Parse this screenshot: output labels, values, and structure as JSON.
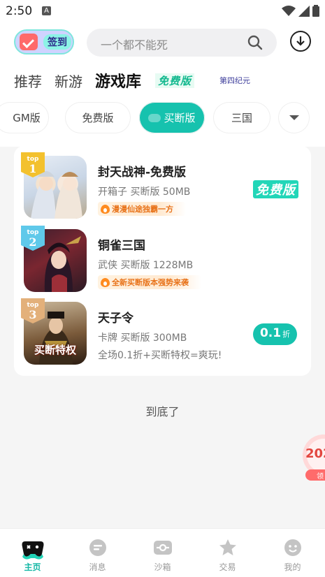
{
  "status_bar": {
    "time": "2:50",
    "badge": "A"
  },
  "header": {
    "signin_label": "签到",
    "search_placeholder": "一个都不能死"
  },
  "top_tabs": [
    {
      "label": "推荐"
    },
    {
      "label": "新游"
    },
    {
      "label": "游戏库"
    },
    {
      "label": "免费版"
    },
    {
      "label": "第四纪元"
    }
  ],
  "chips": [
    {
      "label": "GM版"
    },
    {
      "label": "免费版"
    },
    {
      "label": "买断版"
    },
    {
      "label": "三国"
    }
  ],
  "games": [
    {
      "rank_top": "top",
      "rank": "1",
      "name": "封天战神-免费版",
      "meta": "开箱子 买断版 50MB",
      "tag": "漫漫仙途独霸一方",
      "badge": "免费版"
    },
    {
      "rank_top": "top",
      "rank": "2",
      "name": "铜雀三国",
      "meta": "武侠 买断版 1228MB",
      "tag": "全新买断版本强势来袭"
    },
    {
      "rank_top": "top",
      "rank": "3",
      "name": "天子令",
      "meta": "卡牌 买断版 300MB",
      "sub": "全场0.1折+买断特权=爽玩!",
      "discount_num": "0.1",
      "discount_unit": "折",
      "icon_text": "买断特权"
    }
  ],
  "end_text": "到底了",
  "float_promo": {
    "text": "202",
    "sub": "领"
  },
  "bottom_nav": [
    {
      "label": "主页"
    },
    {
      "label": "消息"
    },
    {
      "label": "沙箱"
    },
    {
      "label": "交易"
    },
    {
      "label": "我的"
    }
  ],
  "colors": {
    "accent": "#16c2ae",
    "tag_orange": "#e8731a"
  }
}
